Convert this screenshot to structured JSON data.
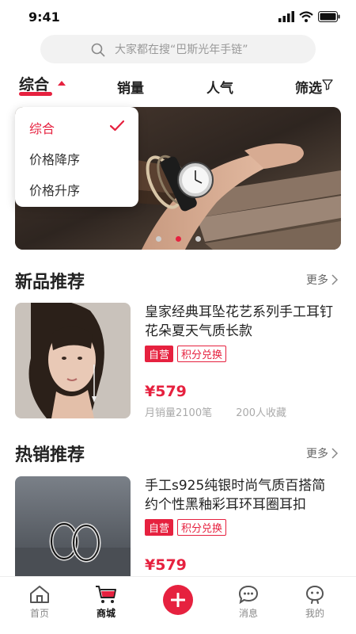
{
  "status": {
    "time": "9:41"
  },
  "search": {
    "placeholder": "大家都在搜“巴斯光年手链”"
  },
  "tabs": [
    {
      "label": "综合",
      "active": true
    },
    {
      "label": "销量"
    },
    {
      "label": "人气"
    },
    {
      "label": "筛选"
    }
  ],
  "dropdown": {
    "items": [
      {
        "label": "综合",
        "selected": true
      },
      {
        "label": "价格降序"
      },
      {
        "label": "价格升序"
      }
    ]
  },
  "banner": {
    "dots": 3,
    "active_dot": 2
  },
  "sections": [
    {
      "title": "新品推荐",
      "more": "更多",
      "product": {
        "title": "皇家经典耳坠花艺系列手工耳钉花朵夏天气质长款",
        "badge_self": "自营",
        "badge_points": "积分兑换",
        "price": "¥579",
        "sales": "月销量2100笔",
        "favorites": "200人收藏"
      }
    },
    {
      "title": "热销推荐",
      "more": "更多",
      "product": {
        "title": "手工s925纯银时尚气质百搭简约个性黑釉彩耳环耳圈耳扣",
        "badge_self": "自营",
        "badge_points": "积分兑换",
        "price": "¥579"
      }
    }
  ],
  "bottom_nav": [
    {
      "label": "首页",
      "icon": "home-icon"
    },
    {
      "label": "商城",
      "icon": "cart-icon",
      "active": true
    },
    {
      "label": "",
      "icon": "plus-icon"
    },
    {
      "label": "消息",
      "icon": "message-icon"
    },
    {
      "label": "我的",
      "icon": "profile-icon"
    }
  ],
  "colors": {
    "accent": "#e6213f",
    "text": "#222222",
    "muted": "#999999"
  }
}
